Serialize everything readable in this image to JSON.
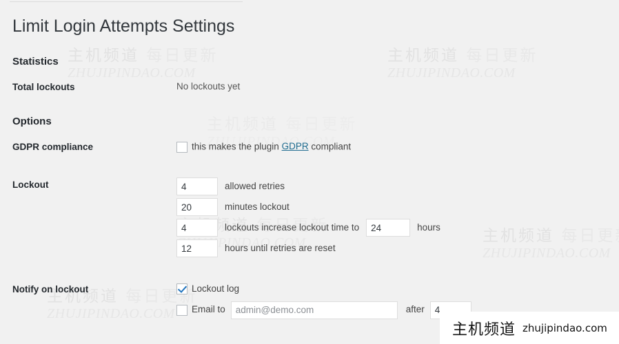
{
  "page": {
    "title": "Limit Login Attempts Settings"
  },
  "statistics": {
    "heading": "Statistics",
    "total_lockouts_label": "Total lockouts",
    "total_lockouts_value": "No lockouts yet"
  },
  "options": {
    "heading": "Options",
    "gdpr": {
      "label": "GDPR compliance",
      "checked": false,
      "text_before": "this makes the plugin",
      "link_text": "GDPR",
      "text_after": "compliant"
    },
    "lockout": {
      "label": "Lockout",
      "allowed_retries_value": "4",
      "allowed_retries_text": "allowed retries",
      "minutes_lockout_value": "20",
      "minutes_lockout_text": "minutes lockout",
      "lockouts_increase_value": "4",
      "lockouts_increase_text": "lockouts increase lockout time to",
      "increase_hours_value": "24",
      "increase_hours_text": "hours",
      "retries_reset_value": "12",
      "retries_reset_text": "hours until retries are reset"
    },
    "notify": {
      "label": "Notify on lockout",
      "lockout_log_label": "Lockout log",
      "lockout_log_checked": true,
      "email_to_label": "Email to",
      "email_to_checked": false,
      "email_placeholder": "admin@demo.com",
      "after_text": "after",
      "after_value": "4"
    }
  },
  "watermarks": {
    "cn_primary": "主机频道",
    "cn_secondary": "每日更新",
    "en": "ZHUJIPINDAO.COM",
    "badge_cn": "主机频道",
    "badge_en": "zhujipindao.com"
  },
  "colors": {
    "background": "#f1f1f1",
    "link": "#1c6a8e",
    "checkmark": "#1e73be",
    "input_border": "#dddddd"
  }
}
